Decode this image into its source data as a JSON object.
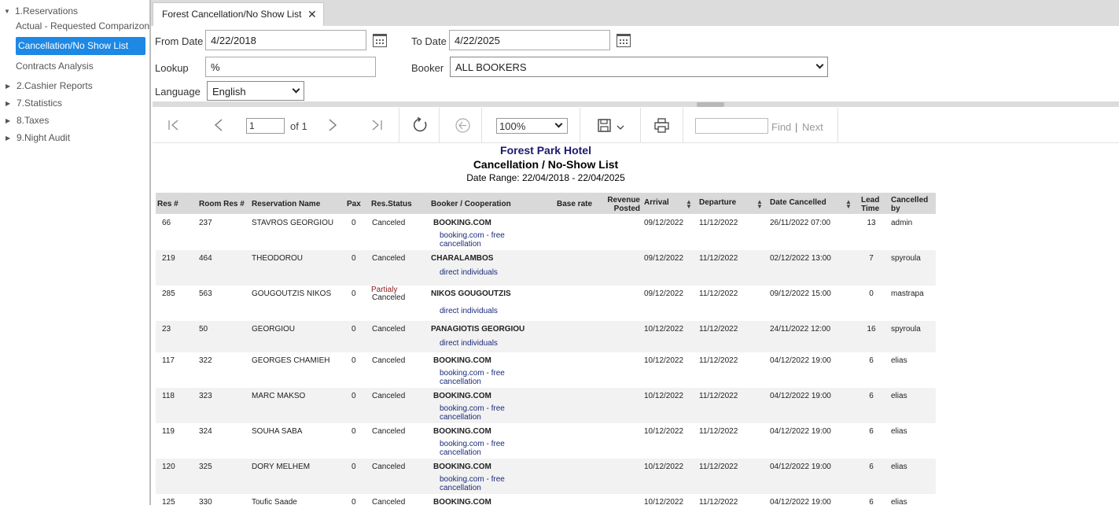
{
  "sidebar": {
    "reservations": "1.Reservations",
    "actual_requested": "Actual - Requested Comparizon",
    "cancellation_list": "Cancellation/No Show List",
    "contracts_analysis": "Contracts Analysis",
    "cashier_reports": "2.Cashier Reports",
    "statistics": "7.Statistics",
    "taxes": "8.Taxes",
    "night_audit": "9.Night Audit"
  },
  "tab": {
    "label": "Forest Cancellation/No Show List",
    "close": "✕"
  },
  "params": {
    "from_date_label": "From Date",
    "from_date": "4/22/2018",
    "to_date_label": "To Date",
    "to_date": "4/22/2025",
    "lookup_label": "Lookup",
    "lookup": "%",
    "booker_label": "Booker",
    "booker": "ALL BOOKERS",
    "language_label": "Language",
    "language": "English"
  },
  "toolbar": {
    "page": "1",
    "of_pages": "of 1",
    "zoom": "100%",
    "find": "Find",
    "sep": "|",
    "next": "Next"
  },
  "report": {
    "hotel": "Forest Park Hotel",
    "title": "Cancellation / No-Show List",
    "date_range": "Date Range: 22/04/2018 - 22/04/2025",
    "columns": {
      "res": "Res #",
      "room_res": "Room Res #",
      "name": "Reservation Name",
      "pax": "Pax",
      "status": "Res.Status",
      "booker": "Booker / Cooperation",
      "base_rate": "Base rate",
      "revenue_1": "Revenue",
      "revenue_2": "Posted",
      "arrival": "Arrival",
      "departure": "Departure",
      "date_cancelled": "Date Cancelled",
      "lead_1": "Lead",
      "lead_2": "Time",
      "cancelled_by_1": "Cancelled",
      "cancelled_by_2": "by"
    },
    "rows": [
      {
        "res": "66",
        "room": "237",
        "name": "STAVROS GEORGIOU",
        "pax": "0",
        "status": "Canceled",
        "booker": "BOOKING.COM",
        "sub1": "booking.com - free",
        "sub2": "cancellation",
        "arrival": "09/12/2022",
        "departure": "11/12/2022",
        "cancelled": "26/11/2022 07:00",
        "lead": "13",
        "by": "admin"
      },
      {
        "res": "219",
        "room": "464",
        "name": "THEODOROU",
        "pax": "0",
        "status": "Canceled",
        "booker": "CHARALAMBOS",
        "sub1": "direct individuals",
        "sub2": "",
        "arrival": "09/12/2022",
        "departure": "11/12/2022",
        "cancelled": "02/12/2022 13:00",
        "lead": "7",
        "by": "spyroula"
      },
      {
        "res": "285",
        "room": "563",
        "name": "GOUGOUTZIS NIKOS",
        "pax": "0",
        "status_partial": "Partialy",
        "status": "Canceled",
        "booker": "NIKOS GOUGOUTZIS",
        "sub1": "direct individuals",
        "sub2": "",
        "arrival": "09/12/2022",
        "departure": "11/12/2022",
        "cancelled": "09/12/2022 15:00",
        "lead": "0",
        "by": "mastrapa"
      },
      {
        "res": "23",
        "room": "50",
        "name": "GEORGIOU",
        "pax": "0",
        "status": "Canceled",
        "booker": "PANAGIOTIS GEORGIOU",
        "sub1": "direct individuals",
        "sub2": "",
        "arrival": "10/12/2022",
        "departure": "11/12/2022",
        "cancelled": "24/11/2022 12:00",
        "lead": "16",
        "by": "spyroula"
      },
      {
        "res": "117",
        "room": "322",
        "name": "GEORGES CHAMIEH",
        "pax": "0",
        "status": "Canceled",
        "booker": "BOOKING.COM",
        "sub1": "booking.com - free",
        "sub2": "cancellation",
        "arrival": "10/12/2022",
        "departure": "11/12/2022",
        "cancelled": "04/12/2022 19:00",
        "lead": "6",
        "by": "elias"
      },
      {
        "res": "118",
        "room": "323",
        "name": "MARC MAKSO",
        "pax": "0",
        "status": "Canceled",
        "booker": "BOOKING.COM",
        "sub1": "booking.com - free",
        "sub2": "cancellation",
        "arrival": "10/12/2022",
        "departure": "11/12/2022",
        "cancelled": "04/12/2022 19:00",
        "lead": "6",
        "by": "elias"
      },
      {
        "res": "119",
        "room": "324",
        "name": "SOUHA SABA",
        "pax": "0",
        "status": "Canceled",
        "booker": "BOOKING.COM",
        "sub1": "booking.com - free",
        "sub2": "cancellation",
        "arrival": "10/12/2022",
        "departure": "11/12/2022",
        "cancelled": "04/12/2022 19:00",
        "lead": "6",
        "by": "elias"
      },
      {
        "res": "120",
        "room": "325",
        "name": "DORY MELHEM",
        "pax": "0",
        "status": "Canceled",
        "booker": "BOOKING.COM",
        "sub1": "booking.com - free",
        "sub2": "cancellation",
        "arrival": "10/12/2022",
        "departure": "11/12/2022",
        "cancelled": "04/12/2022 19:00",
        "lead": "6",
        "by": "elias"
      },
      {
        "res": "125",
        "room": "330",
        "name": "Toufic Saade",
        "pax": "0",
        "status": "Canceled",
        "booker": "BOOKING.COM",
        "sub1": "",
        "sub2": "",
        "arrival": "10/12/2022",
        "departure": "11/12/2022",
        "cancelled": "04/12/2022 19:00",
        "lead": "6",
        "by": "elias"
      }
    ]
  }
}
